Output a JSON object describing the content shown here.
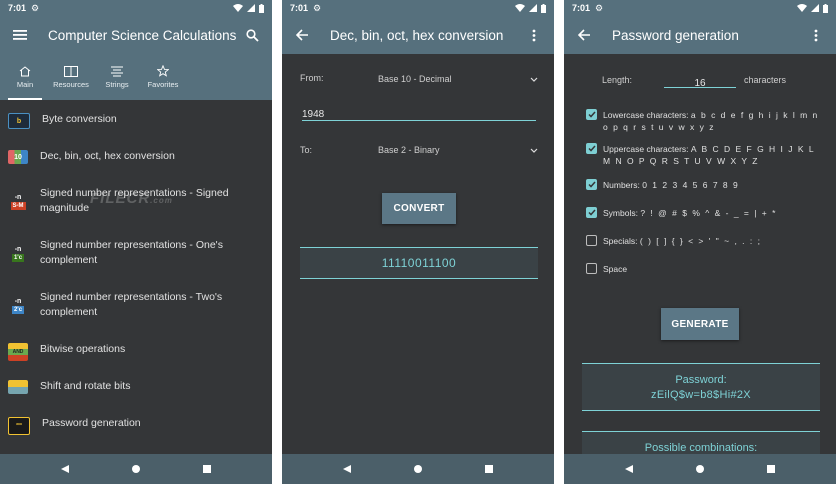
{
  "status": {
    "time": "7:01"
  },
  "screen1": {
    "title": "Computer Science Calculations",
    "tabs": [
      {
        "label": "Main",
        "icon": "home-icon"
      },
      {
        "label": "Resources",
        "icon": "book-icon"
      },
      {
        "label": "Strings",
        "icon": "list-icon"
      },
      {
        "label": "Favorites",
        "icon": "star-icon"
      }
    ],
    "items": [
      {
        "label": "Byte conversion",
        "icon": "byte-icon"
      },
      {
        "label": "Dec, bin, oct, hex conversion",
        "icon": "base-conversion-icon"
      },
      {
        "label": "Signed number representations - Signed magnitude",
        "icon": "signed-magnitude-icon"
      },
      {
        "label": "Signed number representations - One's complement",
        "icon": "ones-complement-icon"
      },
      {
        "label": "Signed number representations - Two's complement",
        "icon": "twos-complement-icon"
      },
      {
        "label": "Bitwise operations",
        "icon": "bitwise-icon"
      },
      {
        "label": "Shift and rotate bits",
        "icon": "shift-icon"
      },
      {
        "label": "Password generation",
        "icon": "password-icon"
      }
    ],
    "watermark": "FILECR",
    "watermark_suffix": ".com"
  },
  "screen2": {
    "title": "Dec, bin, oct, hex conversion",
    "from_label": "From:",
    "from_value": "Base 10 - Decimal",
    "input_value": "1948",
    "to_label": "To:",
    "to_value": "Base 2 - Binary",
    "convert_label": "CONVERT",
    "result": "11110011100"
  },
  "screen3": {
    "title": "Password generation",
    "length_label": "Length:",
    "length_value": "16",
    "length_unit": "characters",
    "options": [
      {
        "label": "Lowercase characters:",
        "chars": "a b c d e f g h i j k l m n o p q r s t u v w x y z",
        "checked": true
      },
      {
        "label": "Uppercase characters:",
        "chars": "A B C D E F G H I J K L M N O P Q R S T U V W X Y Z",
        "checked": true
      },
      {
        "label": "Numbers:",
        "chars": "0 1 2 3 4 5 6 7 8 9",
        "checked": true
      },
      {
        "label": "Symbols:",
        "chars": "? ! @ # $ % ^ & - _ = | + *",
        "checked": true
      },
      {
        "label": "Specials:",
        "chars": "( ) [ ] { } < > ' \" ~ , . : ;",
        "checked": false
      },
      {
        "label": "Space",
        "chars": "",
        "checked": false
      }
    ],
    "generate_label": "GENERATE",
    "password_label": "Password:",
    "password_value": "zEilQ$w=b8$Hi#2X",
    "combinations_label": "Possible combinations:"
  },
  "colors": {
    "appbar": "#56707d",
    "background": "#343638",
    "accent": "#7ed2d6",
    "button": "#5b7786"
  }
}
